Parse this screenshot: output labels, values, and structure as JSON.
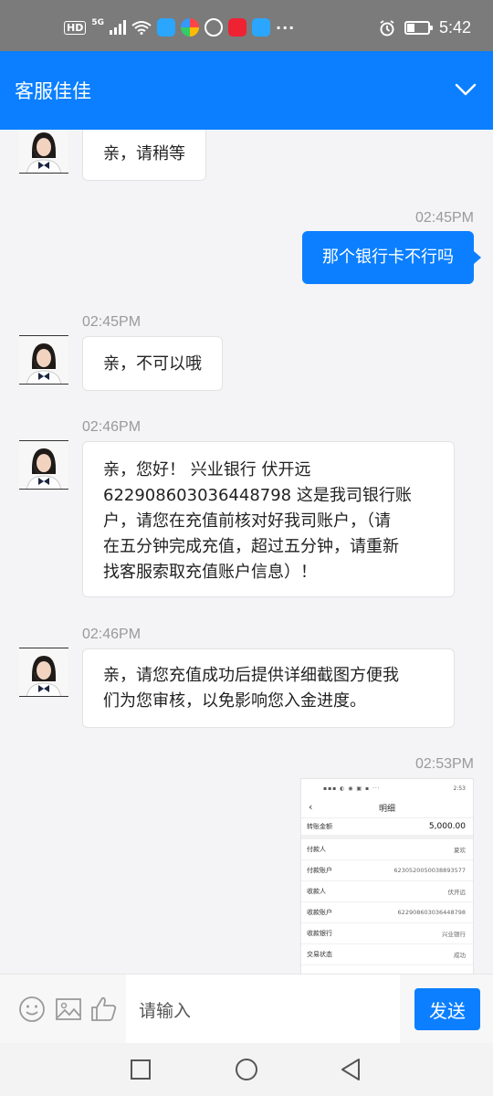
{
  "status_bar": {
    "network_badge": "HD",
    "network_type": "5G",
    "time": "5:42",
    "battery_level": 0.35,
    "more_indicator": "···"
  },
  "header": {
    "title": "客服佳佳",
    "chevron_icon": "chevron-down-icon"
  },
  "messages": [
    {
      "sender": "agent",
      "text": "亲，请稍等"
    },
    {
      "sender": "me",
      "time": "02:45PM",
      "text": "那个银行卡不行吗"
    },
    {
      "sender": "agent",
      "time": "02:45PM",
      "text": "亲，不可以哦"
    },
    {
      "sender": "agent",
      "time": "02:46PM",
      "lines": [
        "亲，您好！ 兴业银行 伏开远",
        "622908603036448798 这是我司银行账",
        "户，请您在充值前核对好我司账户，（请",
        "在五分钟完成充值，超过五分钟，请重新",
        "找客服索取充值账户信息）！"
      ]
    },
    {
      "sender": "agent",
      "time": "02:46PM",
      "lines": [
        "亲，请您充值成功后提供详细截图方便我",
        "们为您审核，以免影响您入金进度。"
      ]
    },
    {
      "sender": "me",
      "time": "02:53PM",
      "type": "image"
    }
  ],
  "receipt": {
    "status_time": "2:53",
    "title": "明细",
    "amount_label": "转账金额",
    "amount": "5,000.00",
    "rows": [
      {
        "label": "付款人",
        "value": "夏欢"
      },
      {
        "label": "付款账户",
        "value": "6230520050038893577"
      },
      {
        "label": "收款人",
        "value": "伏开远"
      },
      {
        "label": "收款账户",
        "value": "622908603036448798"
      },
      {
        "label": "收款银行",
        "value": "兴业银行"
      },
      {
        "label": "交易状态",
        "value": "成功"
      }
    ]
  },
  "input_bar": {
    "placeholder": "请输入",
    "send_label": "发送"
  },
  "colors": {
    "accent": "#0b7fff",
    "status_bar": "#7b7b7b",
    "chat_bg": "#f4f4f6"
  }
}
